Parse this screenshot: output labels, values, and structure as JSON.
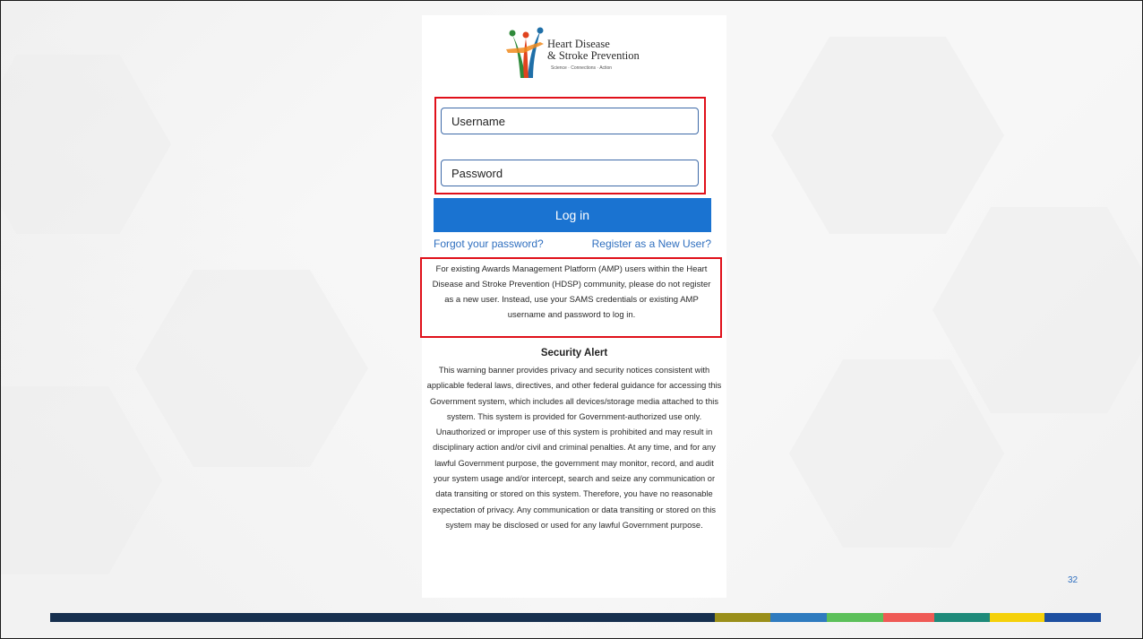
{
  "logo": {
    "line1": "Heart Disease",
    "line2": "& Stroke Prevention",
    "tagline": "Science · Connections · Action"
  },
  "login": {
    "username_placeholder": "Username",
    "password_placeholder": "Password",
    "login_label": "Log in",
    "forgot_link": "Forgot your password?",
    "register_link": "Register as a New User?"
  },
  "amp_note": "For existing Awards Management Platform (AMP) users within the Heart Disease and Stroke Prevention (HDSP) community, please do not register as a new user. Instead, use your SAMS credentials or existing AMP username and password to log in.",
  "security": {
    "title": "Security Alert",
    "body": "This warning banner provides privacy and security notices consistent with applicable federal laws, directives, and other federal guidance for accessing this Government system, which includes all devices/storage media attached to this system. This system is provided for Government-authorized use only. Unauthorized or improper use of this system is prohibited and may result in disciplinary action and/or civil and criminal penalties. At any time, and for any lawful Government purpose, the government may monitor, record, and audit your system usage and/or intercept, search and seize any communication or data transiting or stored on this system. Therefore, you have no reasonable expectation of privacy. Any communication or data transiting or stored on this system may be disclosed or used for any lawful Government purpose."
  },
  "slide": {
    "page_number": "32"
  },
  "colors": {
    "accent_blue": "#1a73d1",
    "link_blue": "#2f6fbf",
    "highlight_red": "#e0101a",
    "footer_bar": [
      "#17304f",
      "#9a8f1a",
      "#2f7bbf",
      "#5cc05a",
      "#ef5a55",
      "#1e8a7a",
      "#f5d10a",
      "#1e4fa0"
    ]
  }
}
